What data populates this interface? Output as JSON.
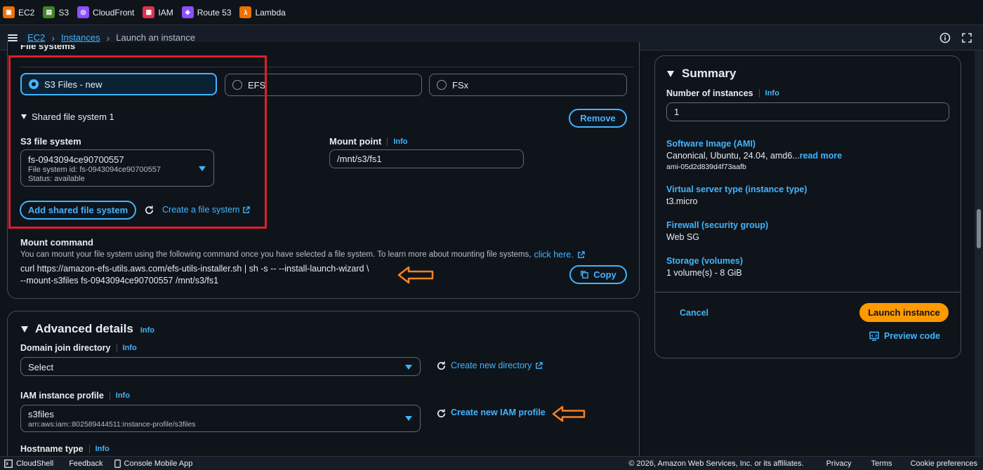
{
  "favorites": [
    {
      "label": "EC2",
      "color": "#ed7100",
      "glyph": "▣"
    },
    {
      "label": "S3",
      "color": "#3f8624",
      "glyph": "▤"
    },
    {
      "label": "CloudFront",
      "color": "#8c4fff",
      "glyph": "◎"
    },
    {
      "label": "IAM",
      "color": "#dd344c",
      "glyph": "▦"
    },
    {
      "label": "Route 53",
      "color": "#8c4fff",
      "glyph": "◈"
    },
    {
      "label": "Lambda",
      "color": "#ed7100",
      "glyph": "λ"
    }
  ],
  "breadcrumb": {
    "ec2": "EC2",
    "instances": "Instances",
    "current": "Launch an instance"
  },
  "file_systems": {
    "section_title": "File systems",
    "tiles": [
      "S3 Files - new",
      "EFS",
      "FSx"
    ],
    "selected_tile": "S3 Files - new",
    "shared_heading": "Shared file system 1",
    "remove_label": "Remove",
    "s3_fs_label": "S3 file system",
    "s3_fs_value": "fs-0943094ce90700557",
    "s3_fs_id": "File system id: fs-0943094ce90700557",
    "s3_fs_status": "Status: available",
    "mount_point_label": "Mount point",
    "mount_point_value": "/mnt/s3/fs1",
    "add_shared_label": "Add shared file system",
    "create_fs_label": "Create a file system",
    "mount_command_label": "Mount command",
    "mount_command_desc": "You can mount your file system using the following command once you have selected a file system. To learn more about mounting file systems,",
    "click_here": "click here.",
    "command_line1": "curl https://amazon-efs-utils.aws.com/efs-utils-installer.sh | sh -s -- --install-launch-wizard \\",
    "command_line2": "--mount-s3files fs-0943094ce90700557 /mnt/s3/fs1",
    "copy_label": "Copy"
  },
  "info_label": "Info",
  "advanced": {
    "title": "Advanced details",
    "domain_label": "Domain join directory",
    "domain_value": "Select",
    "create_directory": "Create new directory",
    "iam_label": "IAM instance profile",
    "iam_value": "s3files",
    "iam_arn": "arn:aws:iam::802589444511:instance-profile/s3files",
    "create_iam": "Create new IAM profile",
    "hostname_label": "Hostname type"
  },
  "summary": {
    "title": "Summary",
    "num_instances_label": "Number of instances",
    "num_instances_value": "1",
    "ami_key": "Software Image (AMI)",
    "ami_value": "Canonical, Ubuntu, 24.04, amd6...",
    "read_more": "read more",
    "ami_id": "ami-05d2d839d4f73aafb",
    "type_key": "Virtual server type (instance type)",
    "type_value": "t3.micro",
    "firewall_key": "Firewall (security group)",
    "firewall_value": "Web SG",
    "storage_key": "Storage (volumes)",
    "storage_value": "1 volume(s) - 8 GiB",
    "cancel_label": "Cancel",
    "launch_label": "Launch instance",
    "preview_label": "Preview code"
  },
  "footer": {
    "cloudshell": "CloudShell",
    "feedback": "Feedback",
    "mobile_app": "Console Mobile App",
    "copyright": "© 2026, Amazon Web Services, Inc. or its affiliates.",
    "privacy": "Privacy",
    "terms": "Terms",
    "cookies": "Cookie preferences"
  },
  "colors": {
    "accent": "#42b4ff",
    "primary": "#ff9900",
    "highlight": "#e01e2b",
    "arrow": "#f58220"
  }
}
